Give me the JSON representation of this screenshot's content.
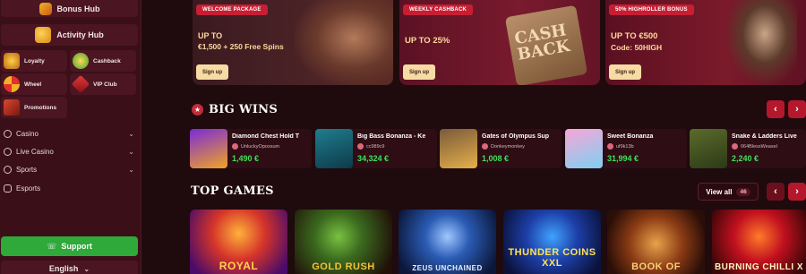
{
  "sidebar": {
    "bonus_hub": "Bonus Hub",
    "activity_hub": "Activity Hub",
    "grid": [
      {
        "label": "Loyalty",
        "icon": "loyalty-icon"
      },
      {
        "label": "Cashback",
        "icon": "cashback-icon"
      },
      {
        "label": "Wheel",
        "icon": "wheel-icon"
      },
      {
        "label": "VIP Club",
        "icon": "vip-club-icon"
      },
      {
        "label": "Promotions",
        "icon": "promotions-icon"
      }
    ],
    "nav": [
      {
        "label": "Casino",
        "icon": "casino-icon"
      },
      {
        "label": "Live Casino",
        "icon": "live-casino-icon"
      },
      {
        "label": "Sports",
        "icon": "sports-icon"
      },
      {
        "label": "Esports",
        "icon": "esports-icon"
      }
    ],
    "support": "Support",
    "language": "English"
  },
  "promos": [
    {
      "tag": "WELCOME PACKAGE",
      "line1": "UP TO",
      "line2": "€1,500 + 250 Free Spins",
      "cta": "Sign up"
    },
    {
      "tag": "WEEKLY CASHBACK",
      "line1": "UP TO 25%",
      "line2": "",
      "cta": "Sign up"
    },
    {
      "tag": "50% HIGHROLLER BONUS",
      "line1": "UP TO €500",
      "line2": "Code: 50HIGH",
      "cta": "Sign up"
    }
  ],
  "big_wins": {
    "title": "BIG WINS",
    "cards": [
      {
        "game": "Diamond Chest Hold T",
        "user": "UnluckyOpossum",
        "amount": "1,490 €"
      },
      {
        "game": "Big Bass Bonanza - Ke",
        "user": "cc989c9",
        "amount": "34,324 €"
      },
      {
        "game": "Gates of Olympus Sup",
        "user": "Donkeymonkey",
        "amount": "1,008 €"
      },
      {
        "game": "Sweet Bonanza",
        "user": "uf9k13b",
        "amount": "31,994 €"
      },
      {
        "game": "Snake & Ladders Live",
        "user": "064BlessWeasel",
        "amount": "2,240 €"
      }
    ]
  },
  "top_games": {
    "title": "TOP GAMES",
    "view_all": "View all",
    "count": "46",
    "tiles": [
      "ROYAL",
      "GOLD RUSH",
      "ZEUS UNCHAINED",
      "THUNDER COINS XXL",
      "BOOK OF",
      "BURNING CHILLI X"
    ]
  },
  "arrows": {
    "prev": "‹",
    "next": "›"
  },
  "colors": {
    "accent": "#b5172c",
    "win_amount": "#41e05a",
    "support": "#2fa93a"
  }
}
